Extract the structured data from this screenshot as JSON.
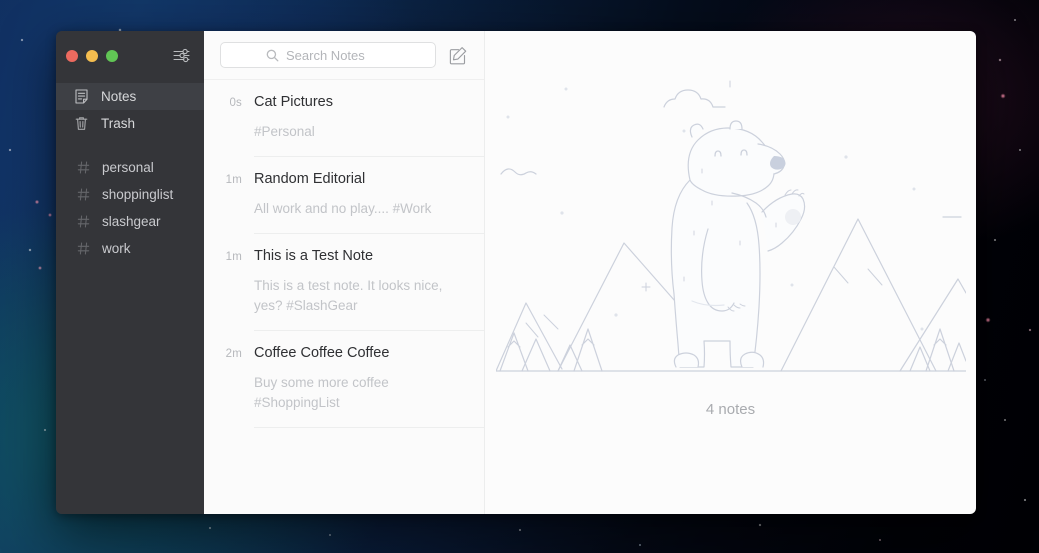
{
  "window": {
    "traffic_lights": [
      {
        "name": "close",
        "color": "#ec6a5f"
      },
      {
        "name": "minimize",
        "color": "#f4bd4f"
      },
      {
        "name": "zoom",
        "color": "#61c555"
      }
    ]
  },
  "sidebar": {
    "settings_icon": "sliders-icon",
    "primary": [
      {
        "label": "Notes",
        "icon": "note-document-icon",
        "active": true
      },
      {
        "label": "Trash",
        "icon": "trash-icon",
        "active": false
      }
    ],
    "tags": [
      {
        "label": "personal",
        "icon": "hash-icon"
      },
      {
        "label": "shoppinglist",
        "icon": "hash-icon"
      },
      {
        "label": "slashgear",
        "icon": "hash-icon"
      },
      {
        "label": "work",
        "icon": "hash-icon"
      }
    ]
  },
  "toolbar": {
    "search": {
      "placeholder": "Search Notes",
      "value": "",
      "icon": "search-icon"
    },
    "compose": {
      "icon": "compose-pencil-icon",
      "label": "New Note"
    }
  },
  "notes": [
    {
      "time": "0s",
      "title": "Cat Pictures",
      "preview": "#Personal"
    },
    {
      "time": "1m",
      "title": "Random Editorial",
      "preview": "All work and no play.... #Work"
    },
    {
      "time": "1m",
      "title": "This is a Test Note",
      "preview": "This is a test note. It looks nice, yes? #SlashGear"
    },
    {
      "time": "2m",
      "title": "Coffee Coffee Coffee",
      "preview": "Buy some more coffee #ShoppingList"
    }
  ],
  "detail": {
    "illustration": "waving-polar-bear-mountains-illustration",
    "notes_count_label": "4 notes"
  },
  "colors": {
    "sidebar_bg": "#343539",
    "sidebar_active": "#3e4045",
    "list_bg": "#fbfbfb",
    "detail_bg": "#fcfcfc",
    "title_text": "#2f3033",
    "muted_text": "#c2c4c8",
    "illustration_line": "#ccd1dc"
  }
}
